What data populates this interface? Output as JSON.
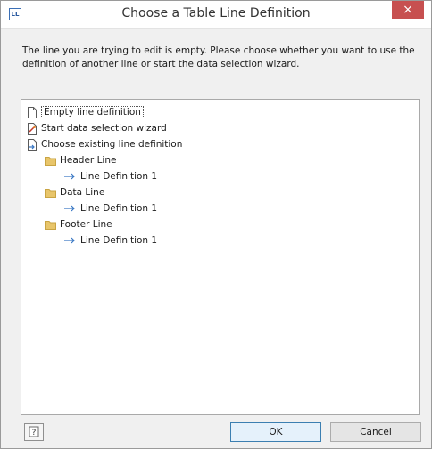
{
  "window": {
    "app_icon_text": "LL",
    "title": "Choose a Table Line Definition",
    "close_glyph": "×"
  },
  "message": "The line you are trying to edit is empty. Please choose whether you want to use the definition of another line or start the data selection wizard.",
  "tree": {
    "items": [
      {
        "label": "Empty line definition",
        "icon": "blank-document-icon",
        "selected": true
      },
      {
        "label": "Start data selection wizard",
        "icon": "wizard-icon"
      },
      {
        "label": "Choose existing line definition",
        "icon": "document-arrow-icon"
      },
      {
        "label": "Header Line",
        "icon": "folder-icon"
      },
      {
        "label": "Line Definition  1",
        "icon": "arrow-icon"
      },
      {
        "label": "Data Line",
        "icon": "folder-icon"
      },
      {
        "label": "Line Definition  1",
        "icon": "arrow-icon"
      },
      {
        "label": "Footer Line",
        "icon": "folder-icon"
      },
      {
        "label": "Line Definition 1",
        "icon": "arrow-icon"
      }
    ]
  },
  "buttons": {
    "help_icon": "help-icon",
    "ok": "OK",
    "cancel": "Cancel"
  },
  "colors": {
    "close": "#c75050",
    "folder": "#e8c56a",
    "arrow": "#3a78c4"
  }
}
